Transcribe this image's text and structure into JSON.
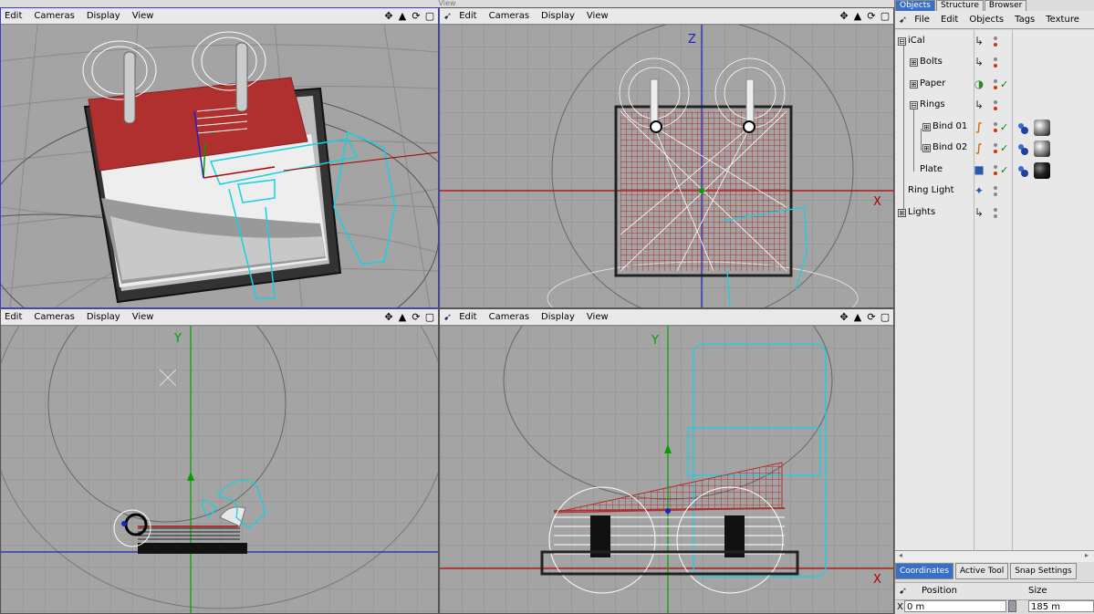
{
  "app": {
    "title": "View"
  },
  "viewport_menu": [
    "Edit",
    "Cameras",
    "Display",
    "View"
  ],
  "nav_icons": [
    "✥",
    "▲",
    "⟳",
    "▢"
  ],
  "axes": {
    "z": "Z",
    "x": "X",
    "y": "Y"
  },
  "colors": {
    "viewport_bg": "#a4a4a4",
    "grid": "#8e8e8e",
    "calendar_red": "#b03030",
    "cyan_wire": "#18d0e0",
    "axis_red": "#b00000",
    "axis_green": "#00a000",
    "axis_blue": "#2020c0"
  },
  "object_manager": {
    "tabs": [
      "Objects",
      "Structure",
      "Browser"
    ],
    "menu": [
      "File",
      "Edit",
      "Objects",
      "Tags",
      "Texture"
    ],
    "objects": [
      {
        "name": "iCal",
        "icon": "null-axis-icon",
        "glyph": "↳",
        "expander": "⊟"
      },
      {
        "name": "Bolts",
        "icon": "null-axis-icon",
        "glyph": "↳",
        "expander": "⊞"
      },
      {
        "name": "Paper",
        "icon": "sphere-material-icon",
        "glyph": "◑",
        "expander": "⊞"
      },
      {
        "name": "Rings",
        "icon": "null-axis-icon",
        "glyph": "↳",
        "expander": "⊟"
      },
      {
        "name": "Bind 01",
        "icon": "bend-deformer-icon",
        "glyph": "∫",
        "expander": "⊞"
      },
      {
        "name": "Bind 02",
        "icon": "bend-deformer-icon",
        "glyph": "∫",
        "expander": "⊞"
      },
      {
        "name": "Plate",
        "icon": "cube-icon",
        "glyph": "■",
        "expander": ""
      },
      {
        "name": "Ring Light",
        "icon": "light-icon",
        "glyph": "✦",
        "expander": ""
      },
      {
        "name": "Lights",
        "icon": "null-axis-icon",
        "glyph": "↳",
        "expander": "⊞"
      }
    ]
  },
  "attributes": {
    "tabs": [
      "Coordinates",
      "Active Tool",
      "Snap Settings"
    ],
    "position_label": "Position",
    "size_label": "Size",
    "x_axis": "X",
    "x_position": "0 m",
    "x_size": "185 m"
  }
}
